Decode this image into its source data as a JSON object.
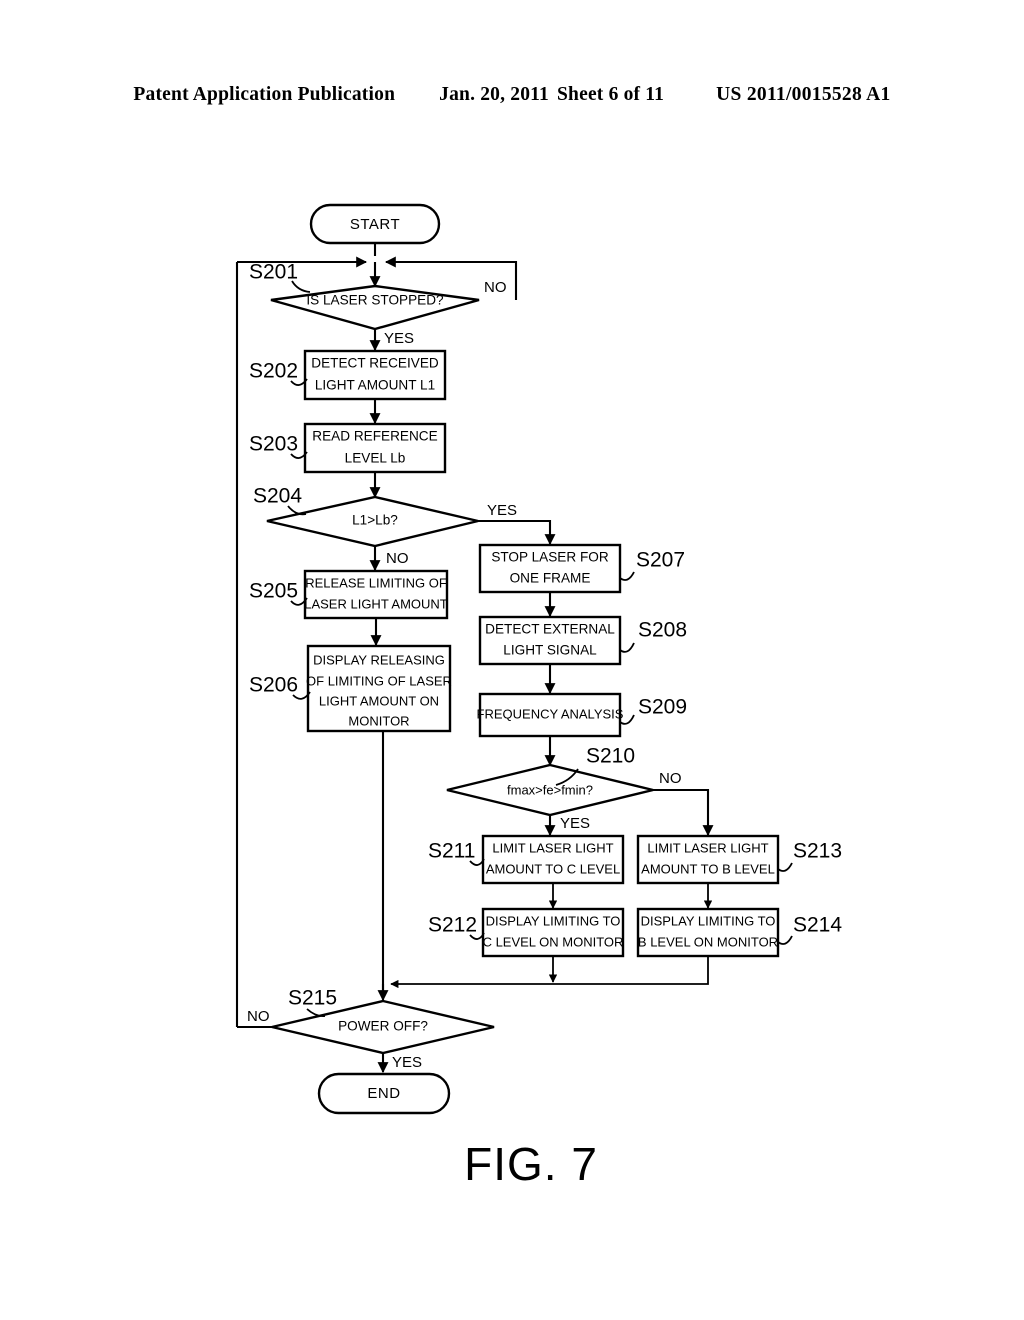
{
  "header": {
    "publication": "Patent Application Publication",
    "date": "Jan. 20, 2011",
    "sheet": "Sheet 6 of 11",
    "patent_number": "US 2011/0015528 A1"
  },
  "figure": {
    "caption": "FIG. 7",
    "title": "Laser light amount control flowchart"
  },
  "flowchart": {
    "terminals": {
      "start": "START",
      "end": "END"
    },
    "branch_labels": {
      "yes": "YES",
      "no": "NO"
    },
    "steps": [
      {
        "id": "S201",
        "label": "S201",
        "type": "decision",
        "text": "IS LASER STOPPED?"
      },
      {
        "id": "S202",
        "label": "S202",
        "type": "process",
        "text_line1": "DETECT RECEIVED",
        "text_line2": "LIGHT AMOUNT L1"
      },
      {
        "id": "S203",
        "label": "S203",
        "type": "process",
        "text_line1": "READ REFERENCE",
        "text_line2": "LEVEL Lb"
      },
      {
        "id": "S204",
        "label": "S204",
        "type": "decision",
        "text": "L1>Lb?"
      },
      {
        "id": "S205",
        "label": "S205",
        "type": "process",
        "text_line1": "RELEASE LIMITING OF",
        "text_line2": "LASER LIGHT AMOUNT"
      },
      {
        "id": "S206",
        "label": "S206",
        "type": "process",
        "text_line1": "DISPLAY RELEASING",
        "text_line2": "OF LIMITING OF LASER",
        "text_line3": "LIGHT AMOUNT ON",
        "text_line4": "MONITOR"
      },
      {
        "id": "S207",
        "label": "S207",
        "type": "process",
        "text_line1": "STOP LASER FOR",
        "text_line2": "ONE FRAME"
      },
      {
        "id": "S208",
        "label": "S208",
        "type": "process",
        "text_line1": "DETECT EXTERNAL",
        "text_line2": "LIGHT SIGNAL"
      },
      {
        "id": "S209",
        "label": "S209",
        "type": "process",
        "text_line1": "FREQUENCY ANALYSIS"
      },
      {
        "id": "S210",
        "label": "S210",
        "type": "decision",
        "text": "fmax>fe>fmin?"
      },
      {
        "id": "S211",
        "label": "S211",
        "type": "process",
        "text_line1": "LIMIT LASER LIGHT",
        "text_line2": "AMOUNT TO C LEVEL"
      },
      {
        "id": "S212",
        "label": "S212",
        "type": "process",
        "text_line1": "DISPLAY LIMITING TO",
        "text_line2": "C LEVEL ON MONITOR"
      },
      {
        "id": "S213",
        "label": "S213",
        "type": "process",
        "text_line1": "LIMIT LASER LIGHT",
        "text_line2": "AMOUNT TO B LEVEL"
      },
      {
        "id": "S214",
        "label": "S214",
        "type": "process",
        "text_line1": "DISPLAY LIMITING TO",
        "text_line2": "B LEVEL ON MONITOR"
      },
      {
        "id": "S215",
        "label": "S215",
        "type": "decision",
        "text": "POWER OFF?"
      }
    ]
  },
  "colors": {
    "ink": "#000000",
    "paper": "#ffffff"
  }
}
